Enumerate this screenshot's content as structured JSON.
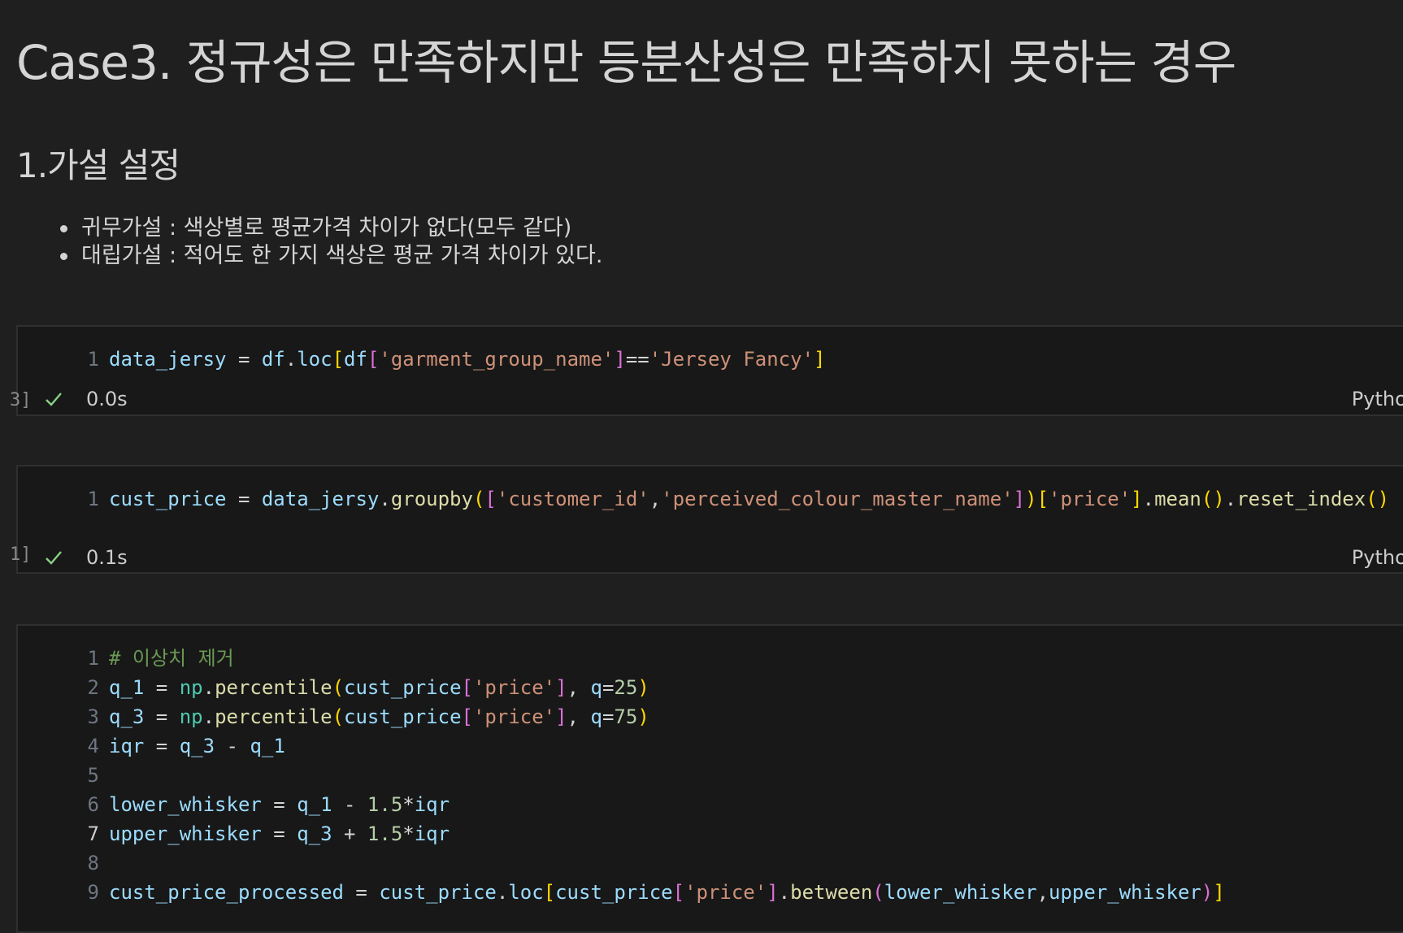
{
  "markdown": {
    "title": "Case3. 정규성은 만족하지만 등분산성은 만족하지 못하는 경우",
    "section": "1.가설 설정",
    "bullets": [
      "귀무가설 : 색상별로 평균가격 차이가 없다(모두 같다)",
      "대립가설 : 적어도 한 가지 색상은 평균 가격 차이가 있다."
    ]
  },
  "cells": [
    {
      "gutter": "3]",
      "lines": [
        {
          "num": "1",
          "tokens": [
            {
              "c": "t-var",
              "t": "data_jersy"
            },
            {
              "c": "t-op",
              "t": " = "
            },
            {
              "c": "t-var",
              "t": "df"
            },
            {
              "c": "t-op",
              "t": "."
            },
            {
              "c": "t-var",
              "t": "loc"
            },
            {
              "c": "t-b1",
              "t": "["
            },
            {
              "c": "t-var",
              "t": "df"
            },
            {
              "c": "t-b2",
              "t": "["
            },
            {
              "c": "t-str",
              "t": "'garment_group_name'"
            },
            {
              "c": "t-b2",
              "t": "]"
            },
            {
              "c": "t-op",
              "t": "=="
            },
            {
              "c": "t-str",
              "t": "'Jersey Fancy'"
            },
            {
              "c": "t-b1",
              "t": "]"
            }
          ]
        }
      ],
      "time": "0.0s",
      "lang": "Python"
    },
    {
      "gutter": "1]",
      "lines": [
        {
          "num": "1",
          "tokens": [
            {
              "c": "t-var",
              "t": "cust_price"
            },
            {
              "c": "t-op",
              "t": " = "
            },
            {
              "c": "t-var",
              "t": "data_jersy"
            },
            {
              "c": "t-op",
              "t": "."
            },
            {
              "c": "t-fn",
              "t": "groupby"
            },
            {
              "c": "t-b1",
              "t": "("
            },
            {
              "c": "t-b2",
              "t": "["
            },
            {
              "c": "t-str",
              "t": "'customer_id'"
            },
            {
              "c": "t-op",
              "t": ","
            },
            {
              "c": "t-str",
              "t": "'perceived_colour_master_name'"
            },
            {
              "c": "t-b2",
              "t": "]"
            },
            {
              "c": "t-b1",
              "t": ")"
            },
            {
              "c": "t-b1",
              "t": "["
            },
            {
              "c": "t-str",
              "t": "'price'"
            },
            {
              "c": "t-b1",
              "t": "]"
            },
            {
              "c": "t-op",
              "t": "."
            },
            {
              "c": "t-fn",
              "t": "mean"
            },
            {
              "c": "t-b1",
              "t": "()"
            },
            {
              "c": "t-op",
              "t": "."
            },
            {
              "c": "t-fn",
              "t": "reset_index"
            },
            {
              "c": "t-b1",
              "t": "()"
            }
          ]
        }
      ],
      "time": "0.1s",
      "lang": "Python"
    },
    {
      "gutter": "",
      "lines": [
        {
          "num": "1",
          "tokens": [
            {
              "c": "t-com",
              "t": "# 이상치 제거"
            }
          ]
        },
        {
          "num": "2",
          "tokens": [
            {
              "c": "t-var",
              "t": "q_1"
            },
            {
              "c": "t-op",
              "t": " = "
            },
            {
              "c": "t-id",
              "t": "np"
            },
            {
              "c": "t-op",
              "t": "."
            },
            {
              "c": "t-fn",
              "t": "percentile"
            },
            {
              "c": "t-b1",
              "t": "("
            },
            {
              "c": "t-var",
              "t": "cust_price"
            },
            {
              "c": "t-b2",
              "t": "["
            },
            {
              "c": "t-str",
              "t": "'price'"
            },
            {
              "c": "t-b2",
              "t": "]"
            },
            {
              "c": "t-op",
              "t": ", "
            },
            {
              "c": "t-var",
              "t": "q"
            },
            {
              "c": "t-op",
              "t": "="
            },
            {
              "c": "t-num",
              "t": "25"
            },
            {
              "c": "t-b1",
              "t": ")"
            }
          ]
        },
        {
          "num": "3",
          "tokens": [
            {
              "c": "t-var",
              "t": "q_3"
            },
            {
              "c": "t-op",
              "t": " = "
            },
            {
              "c": "t-id",
              "t": "np"
            },
            {
              "c": "t-op",
              "t": "."
            },
            {
              "c": "t-fn",
              "t": "percentile"
            },
            {
              "c": "t-b1",
              "t": "("
            },
            {
              "c": "t-var",
              "t": "cust_price"
            },
            {
              "c": "t-b2",
              "t": "["
            },
            {
              "c": "t-str",
              "t": "'price'"
            },
            {
              "c": "t-b2",
              "t": "]"
            },
            {
              "c": "t-op",
              "t": ", "
            },
            {
              "c": "t-var",
              "t": "q"
            },
            {
              "c": "t-op",
              "t": "="
            },
            {
              "c": "t-num",
              "t": "75"
            },
            {
              "c": "t-b1",
              "t": ")"
            }
          ]
        },
        {
          "num": "4",
          "tokens": [
            {
              "c": "t-var",
              "t": "iqr"
            },
            {
              "c": "t-op",
              "t": " = "
            },
            {
              "c": "t-var",
              "t": "q_3"
            },
            {
              "c": "t-op",
              "t": " - "
            },
            {
              "c": "t-var",
              "t": "q_1"
            }
          ]
        },
        {
          "num": "5",
          "tokens": []
        },
        {
          "num": "6",
          "tokens": [
            {
              "c": "t-var",
              "t": "lower_whisker"
            },
            {
              "c": "t-op",
              "t": " = "
            },
            {
              "c": "t-var",
              "t": "q_1"
            },
            {
              "c": "t-op",
              "t": " - "
            },
            {
              "c": "t-num",
              "t": "1.5"
            },
            {
              "c": "t-op",
              "t": "*"
            },
            {
              "c": "t-var",
              "t": "iqr"
            }
          ]
        },
        {
          "num": "7",
          "active": true,
          "tokens": [
            {
              "c": "t-var",
              "t": "upper_whisker"
            },
            {
              "c": "t-op",
              "t": " = "
            },
            {
              "c": "t-var",
              "t": "q_3"
            },
            {
              "c": "t-op",
              "t": " + "
            },
            {
              "c": "t-num",
              "t": "1.5"
            },
            {
              "c": "t-op",
              "t": "*"
            },
            {
              "c": "t-var",
              "t": "iqr"
            }
          ]
        },
        {
          "num": "8",
          "tokens": []
        },
        {
          "num": "9",
          "tokens": [
            {
              "c": "t-var",
              "t": "cust_price_processed"
            },
            {
              "c": "t-op",
              "t": " = "
            },
            {
              "c": "t-var",
              "t": "cust_price"
            },
            {
              "c": "t-op",
              "t": "."
            },
            {
              "c": "t-var",
              "t": "loc"
            },
            {
              "c": "t-b1",
              "t": "["
            },
            {
              "c": "t-var",
              "t": "cust_price"
            },
            {
              "c": "t-b2",
              "t": "["
            },
            {
              "c": "t-str",
              "t": "'price'"
            },
            {
              "c": "t-b2",
              "t": "]"
            },
            {
              "c": "t-op",
              "t": "."
            },
            {
              "c": "t-fn",
              "t": "between"
            },
            {
              "c": "t-b2",
              "t": "("
            },
            {
              "c": "t-var",
              "t": "lower_whisker"
            },
            {
              "c": "t-op",
              "t": ","
            },
            {
              "c": "t-var",
              "t": "upper_whisker"
            },
            {
              "c": "t-b2",
              "t": ")"
            },
            {
              "c": "t-b1",
              "t": "]"
            }
          ]
        }
      ]
    }
  ]
}
